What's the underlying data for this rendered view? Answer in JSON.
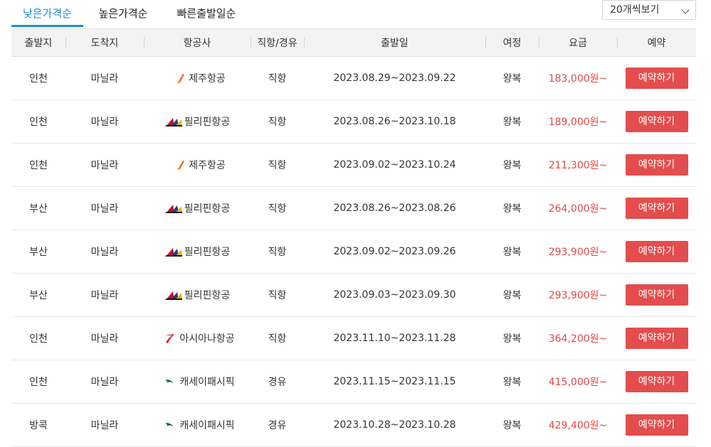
{
  "tabs": [
    {
      "label": "낮은가격순",
      "active": true
    },
    {
      "label": "높은가격순",
      "active": false
    },
    {
      "label": "빠른출발일순",
      "active": false
    }
  ],
  "page_size": {
    "selected": "20개씩보기"
  },
  "columns": [
    "출발지",
    "도착지",
    "항공사",
    "직항/경유",
    "출발일",
    "여정",
    "요금",
    "예약"
  ],
  "colors": {
    "accent": "#1a8fd6",
    "price": "#e04848",
    "button": "#e34d4d"
  },
  "rows": [
    {
      "from": "인천",
      "to": "마닐라",
      "airline": "제주항공",
      "logo": "jeju-air-icon",
      "type": "직항",
      "dates": "2023.08.29~2023.09.22",
      "trip": "왕복",
      "price": "183,000원~",
      "book": "예약하기"
    },
    {
      "from": "인천",
      "to": "마닐라",
      "airline": "필리핀항공",
      "logo": "philippine-airlines-icon",
      "type": "직항",
      "dates": "2023.08.26~2023.10.18",
      "trip": "왕복",
      "price": "189,000원~",
      "book": "예약하기"
    },
    {
      "from": "인천",
      "to": "마닐라",
      "airline": "제주항공",
      "logo": "jeju-air-icon",
      "type": "직항",
      "dates": "2023.09.02~2023.10.24",
      "trip": "왕복",
      "price": "211,300원~",
      "book": "예약하기"
    },
    {
      "from": "부산",
      "to": "마닐라",
      "airline": "필리핀항공",
      "logo": "philippine-airlines-icon",
      "type": "직항",
      "dates": "2023.08.26~2023.08.26",
      "trip": "왕복",
      "price": "264,000원~",
      "book": "예약하기"
    },
    {
      "from": "부산",
      "to": "마닐라",
      "airline": "필리핀항공",
      "logo": "philippine-airlines-icon",
      "type": "직항",
      "dates": "2023.09.02~2023.09.26",
      "trip": "왕복",
      "price": "293,900원~",
      "book": "예약하기"
    },
    {
      "from": "부산",
      "to": "마닐라",
      "airline": "필리핀항공",
      "logo": "philippine-airlines-icon",
      "type": "직항",
      "dates": "2023.09.03~2023.09.30",
      "trip": "왕복",
      "price": "293,900원~",
      "book": "예약하기"
    },
    {
      "from": "인천",
      "to": "마닐라",
      "airline": "아시아나항공",
      "logo": "asiana-airlines-icon",
      "type": "직항",
      "dates": "2023.11.10~2023.11.28",
      "trip": "왕복",
      "price": "364,200원~",
      "book": "예약하기"
    },
    {
      "from": "인천",
      "to": "마닐라",
      "airline": "캐세이패시픽",
      "logo": "cathay-pacific-icon",
      "type": "경유",
      "dates": "2023.11.15~2023.11.15",
      "trip": "왕복",
      "price": "415,000원~",
      "book": "예약하기"
    },
    {
      "from": "방콕",
      "to": "마닐라",
      "airline": "캐세이패시픽",
      "logo": "cathay-pacific-icon",
      "type": "경유",
      "dates": "2023.10.28~2023.10.28",
      "trip": "왕복",
      "price": "429,400원~",
      "book": "예약하기"
    }
  ]
}
